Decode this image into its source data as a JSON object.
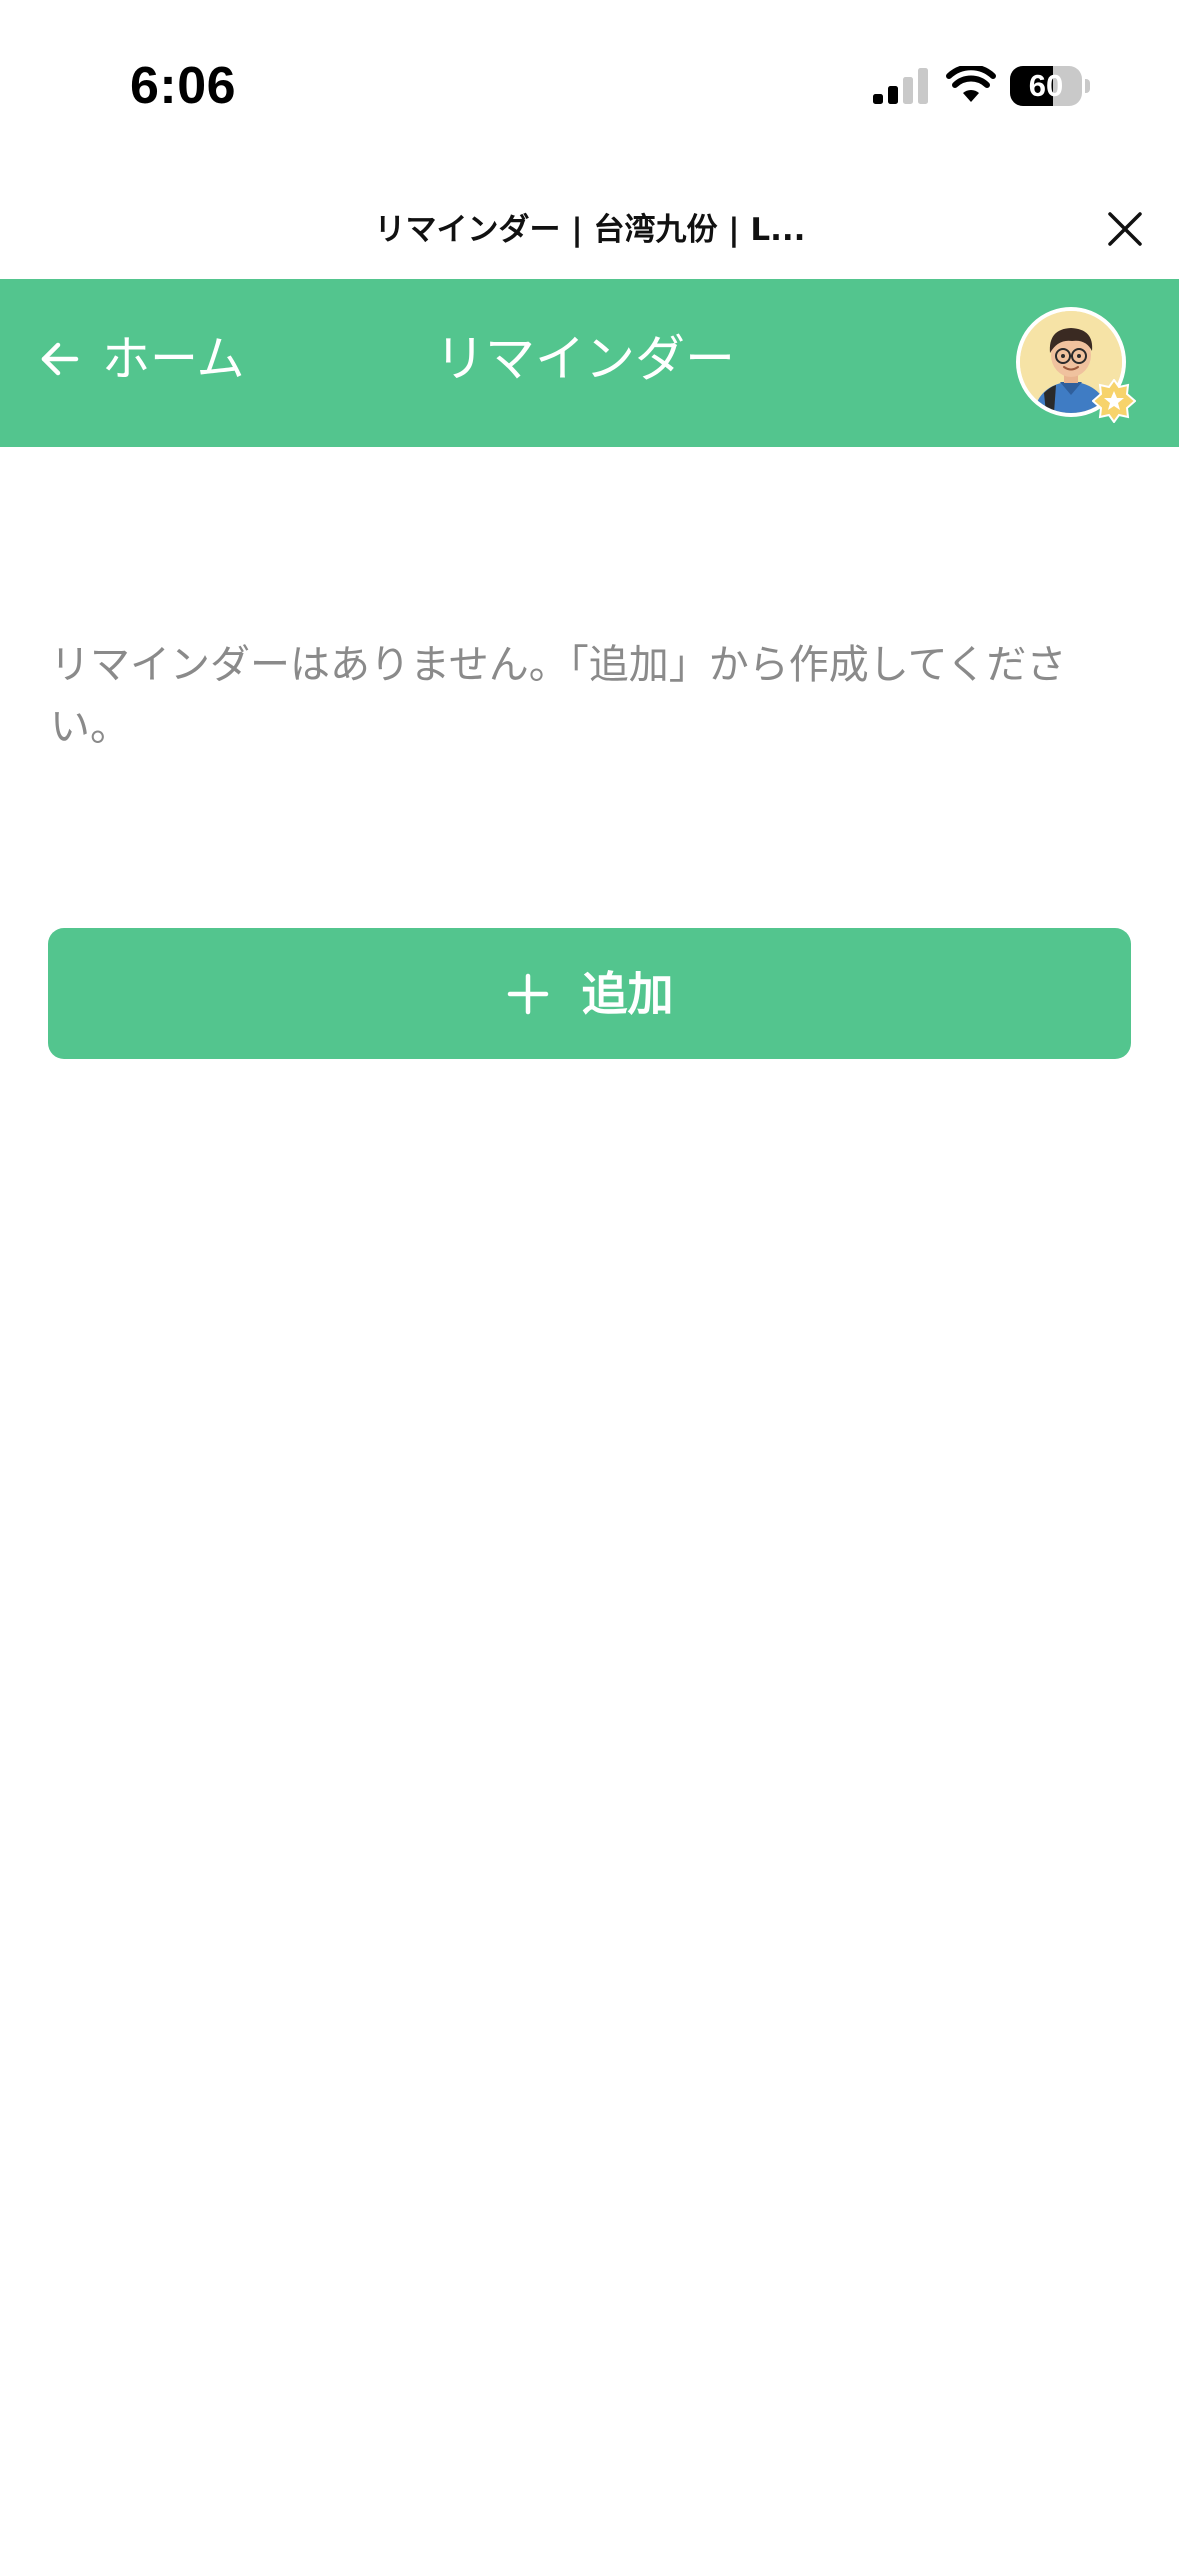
{
  "status_bar": {
    "time": "6:06",
    "battery_level": "60",
    "battery_fraction": 0.6,
    "signal_bars_active": 2,
    "signal_bars_total": 4
  },
  "browser": {
    "title": "リマインダー | 台湾九份 | L...",
    "close_icon": "close-icon"
  },
  "header": {
    "back_label": "ホーム",
    "back_icon": "arrow-left-icon",
    "title": "リマインダー",
    "avatar_icon": "user-avatar",
    "badge_icon": "star-badge-icon"
  },
  "content": {
    "empty_message": "リマインダーはありません。「追加」から作成してください。",
    "add_label": "追加",
    "add_icon": "plus-icon"
  },
  "colors": {
    "brand_green": "#53c58e",
    "muted_text": "#8a8a8a",
    "badge_yellow": "#f7d36b"
  }
}
